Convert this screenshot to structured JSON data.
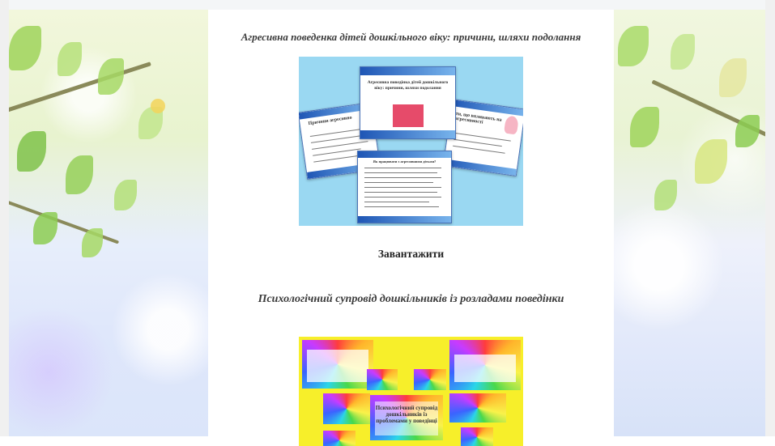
{
  "articles": [
    {
      "title": "Агресивна поведенка дітей дошкільного віку: причини, шляхи подолання",
      "cover": {
        "main_slide_title": "Агресивна поведінка дітей дошкільного віку: причини, шляхи подолання",
        "left_slide_title": "Причини агресивно",
        "right_slide_title": "ти, що впливають на агресивності",
        "bottom_slide_title": "Як працювати з агресивними дітьми?"
      },
      "download_label": "Завантажити"
    },
    {
      "title": "Психологічний супровід дошкільників із розладами поведінки",
      "cover": {
        "center_title": "Психологічний супровід дошкільників із проблемами у поведінці"
      }
    }
  ],
  "colors": {
    "title_text": "#3a3a3a",
    "slide_background": "#9ad8f2",
    "rainbow_background": "#f7ef2a"
  }
}
